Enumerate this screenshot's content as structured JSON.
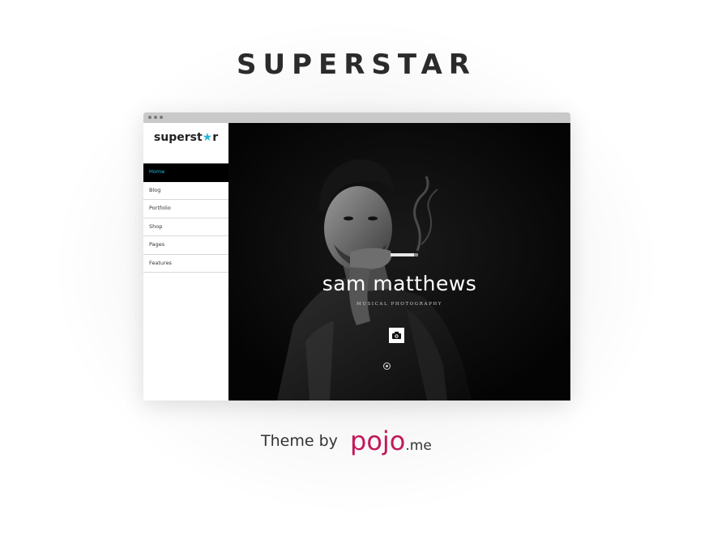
{
  "heading": {
    "title": "SUPERSTAR"
  },
  "preview": {
    "logo": {
      "text": "superst",
      "star": "★",
      "tail": "r"
    },
    "nav": [
      "Home",
      "Blog",
      "Portfolio",
      "Shop",
      "Pages",
      "Features"
    ],
    "active_nav": "Home",
    "hero": {
      "name": "sam matthews",
      "tagline": "MUSICAL PHOTOGRAPHY",
      "camera_icon": "camera-icon"
    }
  },
  "credit": {
    "prefix": "Theme by",
    "brand": "pojo",
    "tld": ".me"
  },
  "colors": {
    "accent": "#29b6d8",
    "brand": "#c2185b",
    "hero_bg": "#040404"
  }
}
